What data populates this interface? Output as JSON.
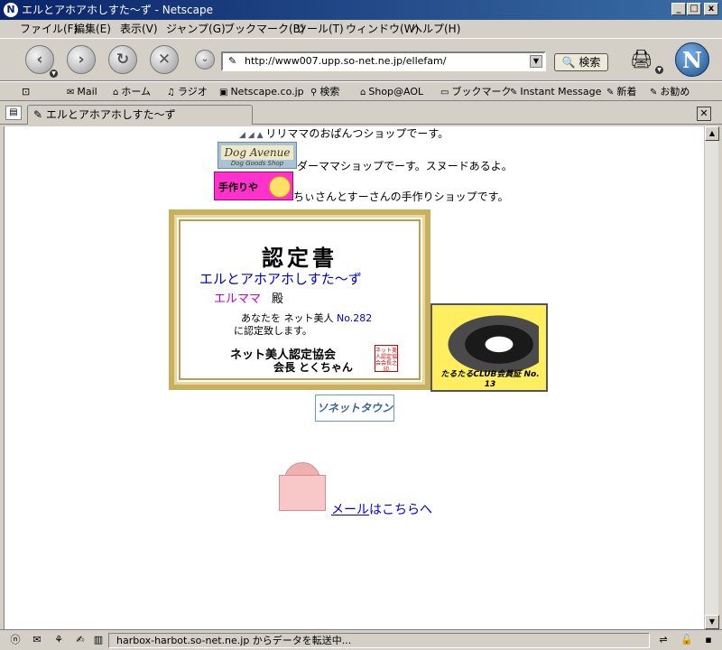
{
  "window": {
    "title": "エルとアホアホしすた〜ず - Netscape",
    "app_icon": "N",
    "btn_min": "_",
    "btn_max": "□",
    "btn_close": "x"
  },
  "menu": {
    "items": [
      "ファイル(F)",
      "編集(E)",
      "表示(V)",
      "ジャンプ(G)",
      "ブックマーク(B)",
      "ツール(T)",
      "ウィンドウ(W)",
      "ヘルプ(H)"
    ]
  },
  "navbar": {
    "back_icon": "back-arrow-icon",
    "forward_icon": "forward-arrow-icon",
    "reload_icon": "reload-icon",
    "stop_icon": "stop-icon",
    "url": "http://www007.upp.so-net.ne.jp/ellefam/",
    "search_label": "検索",
    "logo_letter": "N"
  },
  "personal_toolbar": {
    "items": [
      {
        "label": "Mail",
        "icon": "mail-icon"
      },
      {
        "label": "ホーム",
        "icon": "home-icon"
      },
      {
        "label": "ラジオ",
        "icon": "radio-icon"
      },
      {
        "label": "Netscape.co.jp",
        "icon": "my-netscape-icon"
      },
      {
        "label": "検索",
        "icon": "search-icon"
      },
      {
        "label": "Shop@AOL",
        "icon": "shop-icon"
      },
      {
        "label": "ブックマーク",
        "icon": "bookmark-icon"
      },
      {
        "label": "Instant Message",
        "icon": "bookmark-link-icon"
      },
      {
        "label": "新着",
        "icon": "bookmark-link-icon"
      },
      {
        "label": "お勧め",
        "icon": "bookmark-link-icon"
      }
    ]
  },
  "tab": {
    "title": "エルとアホアホしすた〜ず"
  },
  "content": {
    "shop1_text": "リリママのおぱんつショップでーす。",
    "shop2_banner": "Dog Avenue",
    "shop2_sub": "Dog Goods Shop",
    "shop2_text": "ダーママショップでーす。スヌードあるよ。",
    "shop3_banner": "手作りや",
    "shop3_text": "ちぃさんとすーさんの手作りショップです。",
    "certificate": {
      "title": "認定書",
      "site": "エルとアホアホしすた〜ず",
      "name": "エルママ",
      "dono": "殿",
      "body1_pre": "あなたを ネット美人 ",
      "body1_num": "No.282",
      "body2": "に認定致します。",
      "assoc": "ネット美人認定協会",
      "president": "会長 とくちゃん",
      "seal": "ネット美人認定協会会長之印"
    },
    "dog_badge_caption": "たるたるCLUB会員証 No. 13",
    "sonet_label": "ソネットタウン",
    "mail_link_u": "メール",
    "mail_link_rest": "はこちらへ"
  },
  "statusbar": {
    "text": "harbox-harbot.so-net.ne.jp からデータを転送中..."
  }
}
